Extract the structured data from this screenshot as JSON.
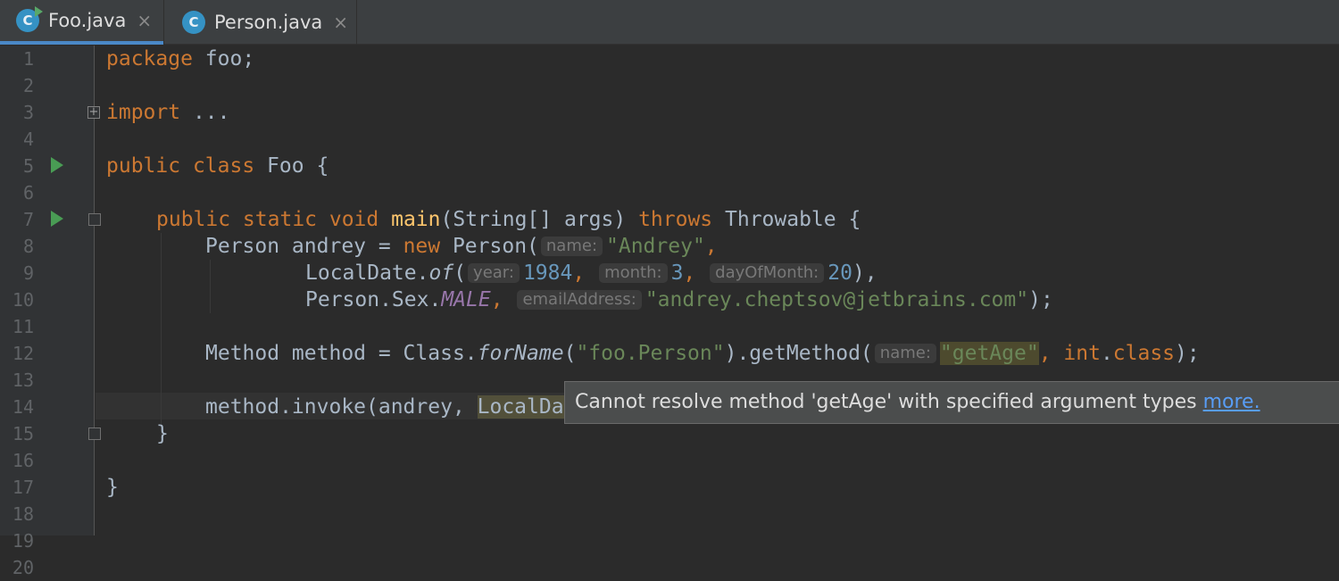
{
  "tabs": [
    {
      "name": "Foo.java",
      "icon": "java-class-icon",
      "icon_letter": "C",
      "active": true,
      "has_run_badge": true
    },
    {
      "name": "Person.java",
      "icon": "java-class-icon",
      "icon_letter": "C",
      "active": false
    }
  ],
  "tab_close_glyph": "×",
  "gutter": {
    "line_numbers": [
      "1",
      "2",
      "3",
      "4",
      "5",
      "6",
      "7",
      "8",
      "9",
      "10",
      "11",
      "12",
      "13",
      "14",
      "15",
      "16",
      "17",
      "18",
      "19",
      "20"
    ],
    "run_icons_on_lines": [
      6,
      8
    ]
  },
  "code": {
    "l1_kw": "package",
    "l1_rest": " foo;",
    "l3_kw": "import",
    "l3_rest": " ...",
    "l6_kw1": "public",
    "l6_kw2": "class",
    "l6_rest": " Foo {",
    "l8_kw": "public static void",
    "l8_fn": "main",
    "l8_mid": "(String[] args) ",
    "l8_kw2": "throws",
    "l8_rest": " Throwable {",
    "l9_a": "Person andrey = ",
    "l9_kw": "new",
    "l9_b": " Person(",
    "l9_hint": "name:",
    "l9_str": "\"Andrey\"",
    "l9_c": ",",
    "l10_a": "LocalDate.",
    "l10_it": "of",
    "l10_b": "(",
    "l10_hint1": "year:",
    "l10_n1": "1984",
    "l10_c1": ",",
    "l10_hint2": "month:",
    "l10_n2": "3",
    "l10_c2": ",",
    "l10_hint3": "dayOfMonth:",
    "l10_n3": "20",
    "l10_end": "),",
    "l11_a": "Person.Sex.",
    "l11_const": "MALE",
    "l11_c": ",",
    "l11_hint": "emailAddress:",
    "l11_str": "\"andrey.cheptsov@jetbrains.com\"",
    "l11_end": ");",
    "l13_a": "Method method = Class.",
    "l13_it": "forName",
    "l13_b": "(",
    "l13_str": "\"foo.Person\"",
    "l13_c": ").getMethod(",
    "l13_hint": "name:",
    "l13_err": "\"getAge\"",
    "l13_d": ", ",
    "l13_kw": "int",
    "l13_e": ".",
    "l13_kw2": "class",
    "l13_end": ");",
    "l15_a": "method.invoke(andrey, ",
    "l15_warn": "LocalDa",
    "l16": "}",
    "l18": "}"
  },
  "tooltip": {
    "message": "Cannot resolve method 'getAge' with specified argument types ",
    "link": "more."
  },
  "colors": {
    "editor_bg": "#2b2b2b",
    "keyword": "#cc7832",
    "string": "#6a8759",
    "number": "#6897bb",
    "function": "#ffc66d",
    "constant": "#9876aa",
    "accent": "#4a88c7"
  }
}
